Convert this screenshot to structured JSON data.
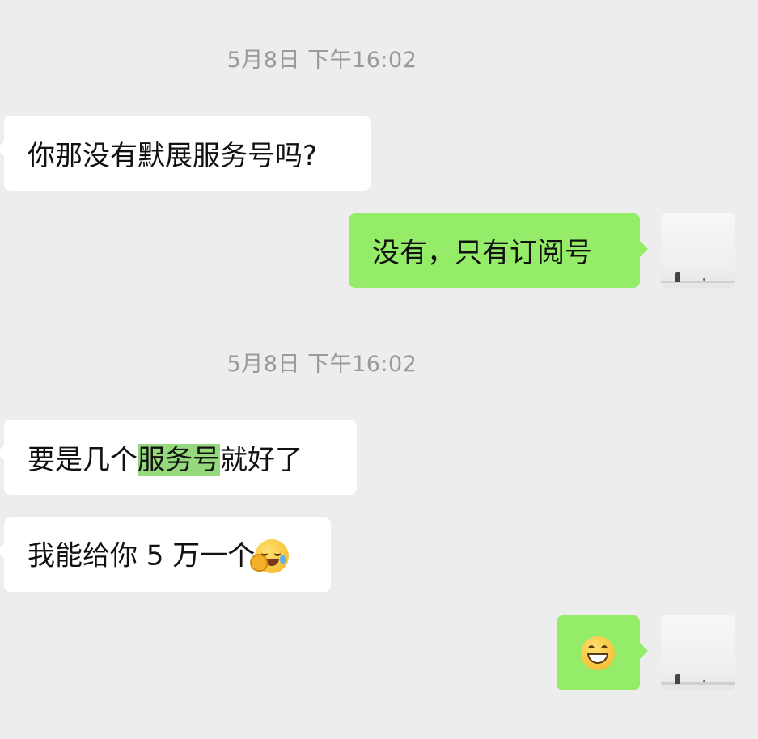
{
  "timestamps": [
    "5月8日 下午16:02",
    "5月8日 下午16:02"
  ],
  "messages": [
    {
      "side": "left",
      "text": "你那没有默展服务号吗?"
    },
    {
      "side": "right",
      "text": "没有，只有订阅号"
    },
    {
      "side": "left",
      "pre": "要是几个",
      "highlight": "服务号",
      "post": "就好了"
    },
    {
      "side": "left",
      "text": "我能给你 5 万一个",
      "emoji": "facepalm-cry"
    },
    {
      "side": "right",
      "emoji": "grinning-face"
    }
  ],
  "colors": {
    "background": "#ededed",
    "incoming_bubble": "#ffffff",
    "outgoing_bubble": "#95ec69",
    "highlight": "#95d97c",
    "timestamp": "#9a9a9a"
  }
}
